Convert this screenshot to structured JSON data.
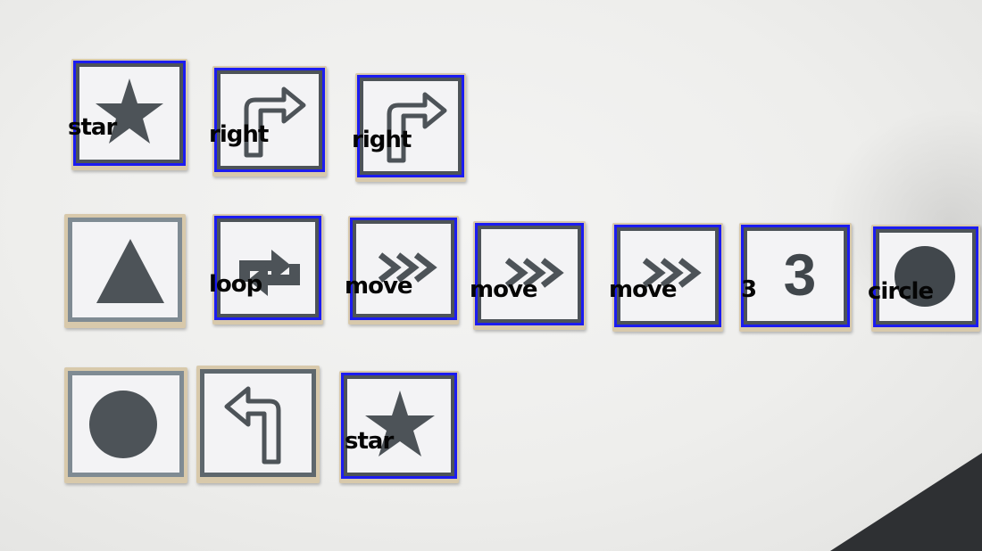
{
  "tiles": [
    {
      "symbol": "star-icon",
      "detected": true,
      "label": "star"
    },
    {
      "symbol": "right-arrow-icon",
      "detected": true,
      "label": "right"
    },
    {
      "symbol": "right-arrow-icon",
      "detected": true,
      "label": "right"
    },
    {
      "symbol": "triangle-icon",
      "detected": false,
      "label": ""
    },
    {
      "symbol": "loop-icon",
      "detected": true,
      "label": "loop"
    },
    {
      "symbol": "chevrons-icon",
      "detected": true,
      "label": "move"
    },
    {
      "symbol": "chevrons-icon",
      "detected": true,
      "label": "move"
    },
    {
      "symbol": "chevrons-icon",
      "detected": true,
      "label": "move"
    },
    {
      "symbol": "number-three-icon",
      "detected": true,
      "label": "3",
      "digit": "3"
    },
    {
      "symbol": "circle-icon",
      "detected": true,
      "label": "circle"
    },
    {
      "symbol": "circle-icon",
      "detected": false,
      "label": ""
    },
    {
      "symbol": "left-arrow-icon",
      "detected": false,
      "label": ""
    },
    {
      "symbol": "star-icon",
      "detected": true,
      "label": "star"
    }
  ],
  "colors": {
    "detection_box": "#1c1cf0",
    "symbol": "#4d5358",
    "tile_face": "#f3f3f5"
  }
}
